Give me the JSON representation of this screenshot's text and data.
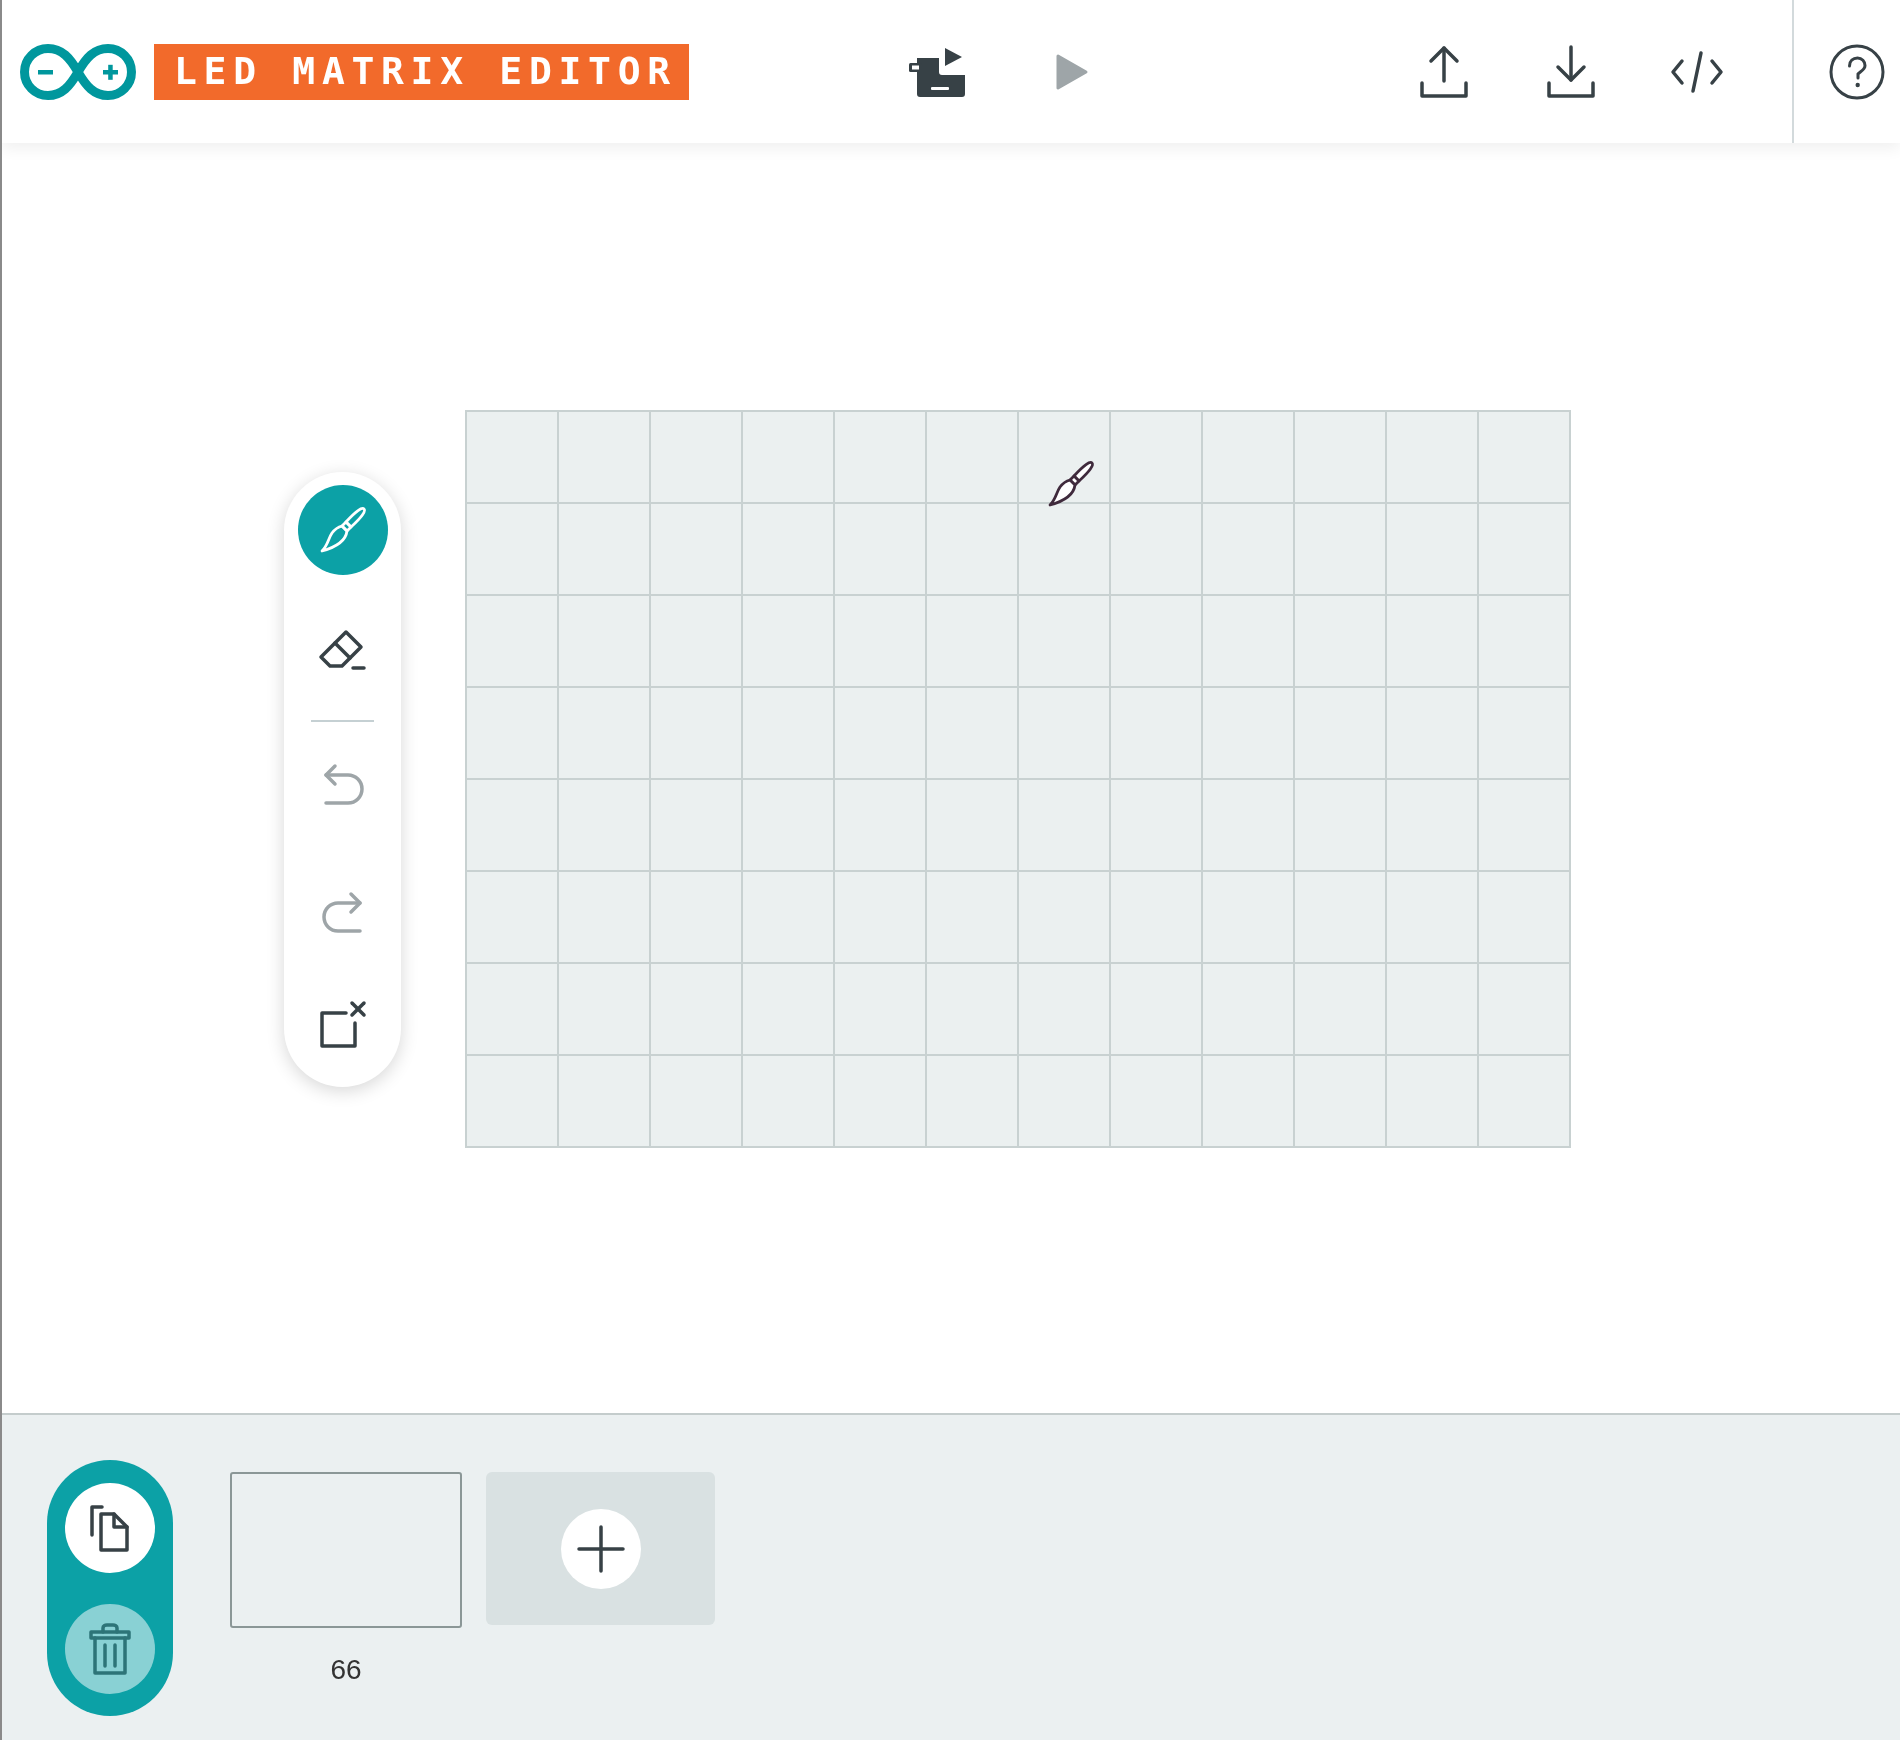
{
  "header": {
    "title": "LED MATRIX EDITOR",
    "run_actions": [
      {
        "kind": "upload_to_board",
        "disabled": false
      },
      {
        "kind": "play",
        "disabled": true
      }
    ]
  },
  "toolbar": {
    "tools": [
      {
        "kind": "brush",
        "selected": true
      },
      {
        "kind": "eraser",
        "selected": false
      }
    ],
    "actions": [
      {
        "kind": "undo",
        "disabled": true
      },
      {
        "kind": "redo",
        "disabled": true
      },
      {
        "kind": "clear",
        "disabled": false
      }
    ]
  },
  "matrix": {
    "rows": [
      {
        "cells": [
          {
            "on": false
          },
          {
            "on": false
          },
          {
            "on": false
          },
          {
            "on": false
          },
          {
            "on": false
          },
          {
            "on": false
          },
          {
            "on": false
          },
          {
            "on": false
          },
          {
            "on": false
          },
          {
            "on": false
          },
          {
            "on": false
          },
          {
            "on": false
          }
        ]
      },
      {
        "cells": [
          {
            "on": false
          },
          {
            "on": false
          },
          {
            "on": false
          },
          {
            "on": false
          },
          {
            "on": false
          },
          {
            "on": false
          },
          {
            "on": false
          },
          {
            "on": false
          },
          {
            "on": false
          },
          {
            "on": false
          },
          {
            "on": false
          },
          {
            "on": false
          }
        ]
      },
      {
        "cells": [
          {
            "on": false
          },
          {
            "on": false
          },
          {
            "on": false
          },
          {
            "on": false
          },
          {
            "on": false
          },
          {
            "on": false
          },
          {
            "on": false
          },
          {
            "on": false
          },
          {
            "on": false
          },
          {
            "on": false
          },
          {
            "on": false
          },
          {
            "on": false
          }
        ]
      },
      {
        "cells": [
          {
            "on": false
          },
          {
            "on": false
          },
          {
            "on": false
          },
          {
            "on": false
          },
          {
            "on": false
          },
          {
            "on": false
          },
          {
            "on": false
          },
          {
            "on": false
          },
          {
            "on": false
          },
          {
            "on": false
          },
          {
            "on": false
          },
          {
            "on": false
          }
        ]
      },
      {
        "cells": [
          {
            "on": false
          },
          {
            "on": false
          },
          {
            "on": false
          },
          {
            "on": false
          },
          {
            "on": false
          },
          {
            "on": false
          },
          {
            "on": false
          },
          {
            "on": false
          },
          {
            "on": false
          },
          {
            "on": false
          },
          {
            "on": false
          },
          {
            "on": false
          }
        ]
      },
      {
        "cells": [
          {
            "on": false
          },
          {
            "on": false
          },
          {
            "on": false
          },
          {
            "on": false
          },
          {
            "on": false
          },
          {
            "on": false
          },
          {
            "on": false
          },
          {
            "on": false
          },
          {
            "on": false
          },
          {
            "on": false
          },
          {
            "on": false
          },
          {
            "on": false
          }
        ]
      },
      {
        "cells": [
          {
            "on": false
          },
          {
            "on": false
          },
          {
            "on": false
          },
          {
            "on": false
          },
          {
            "on": false
          },
          {
            "on": false
          },
          {
            "on": false
          },
          {
            "on": false
          },
          {
            "on": false
          },
          {
            "on": false
          },
          {
            "on": false
          },
          {
            "on": false
          }
        ]
      },
      {
        "cells": [
          {
            "on": false
          },
          {
            "on": false
          },
          {
            "on": false
          },
          {
            "on": false
          },
          {
            "on": false
          },
          {
            "on": false
          },
          {
            "on": false
          },
          {
            "on": false
          },
          {
            "on": false
          },
          {
            "on": false
          },
          {
            "on": false
          },
          {
            "on": false
          }
        ]
      }
    ]
  },
  "frame_actions": [
    {
      "kind": "duplicate",
      "disabled": false
    },
    {
      "kind": "delete",
      "disabled": true
    }
  ],
  "frames": [
    {
      "label": "66",
      "selected": true
    }
  ]
}
